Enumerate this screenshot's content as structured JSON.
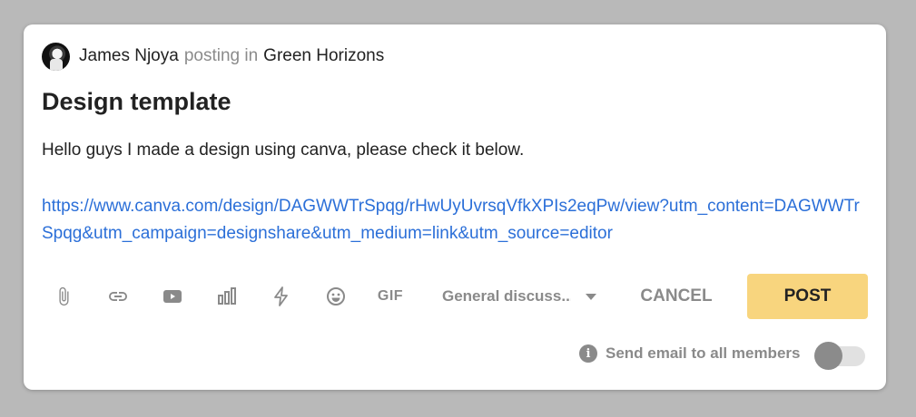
{
  "post": {
    "author": "James Njoya",
    "posting_text": "posting in",
    "group": "Green Horizons",
    "title": "Design template",
    "body": "Hello guys I made a design using canva, please check it below.",
    "link": "https://www.canva.com/design/DAGWWTrSpqg/rHwUyUvrsqVfkXPIs2eqPw/view?utm_content=DAGWWTrSpqg&utm_campaign=designshare&utm_medium=link&utm_source=editor"
  },
  "toolbar": {
    "icons": [
      "attachment-icon",
      "link-icon",
      "youtube-icon",
      "poll-icon",
      "lightning-icon",
      "emoji-icon",
      "gif-icon"
    ],
    "gif_label": "GIF",
    "category": "General discuss...",
    "cancel_label": "CANCEL",
    "post_label": "POST"
  },
  "email_option": {
    "label": "Send email to all members",
    "enabled": false
  },
  "colors": {
    "accent_button": "#f8d57e",
    "link": "#2b6fd8",
    "muted": "#8a8a8a"
  }
}
